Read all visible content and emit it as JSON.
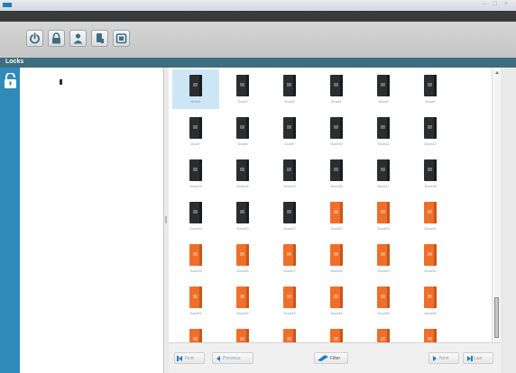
{
  "window": {
    "title": "",
    "controls": "– □ ×"
  },
  "menu": {
    "items": [
      "",
      "",
      ""
    ]
  },
  "toolbar": {
    "buttons": [
      "power-icon",
      "lock-icon",
      "user-icon",
      "device-icon",
      "tablet-icon"
    ]
  },
  "section": {
    "title": "Locks"
  },
  "tree": {
    "items": [
      {
        "label": ""
      },
      {
        "label": ""
      },
      {
        "label": ""
      }
    ]
  },
  "locks": [
    {
      "label": "Door1",
      "color": "black"
    },
    {
      "label": "Door2",
      "color": "black"
    },
    {
      "label": "Door3",
      "color": "black"
    },
    {
      "label": "Door4",
      "color": "black"
    },
    {
      "label": "Door5",
      "color": "black"
    },
    {
      "label": "Door6",
      "color": "black"
    },
    {
      "label": "Door7",
      "color": "black"
    },
    {
      "label": "Door8",
      "color": "black"
    },
    {
      "label": "Door9",
      "color": "black"
    },
    {
      "label": "Door10",
      "color": "black"
    },
    {
      "label": "Door11",
      "color": "black"
    },
    {
      "label": "Door12",
      "color": "black"
    },
    {
      "label": "Door13",
      "color": "black"
    },
    {
      "label": "Door14",
      "color": "black"
    },
    {
      "label": "Door15",
      "color": "black"
    },
    {
      "label": "Door16",
      "color": "black"
    },
    {
      "label": "Door17",
      "color": "black"
    },
    {
      "label": "Door18",
      "color": "black"
    },
    {
      "label": "Door19",
      "color": "black"
    },
    {
      "label": "Door20",
      "color": "black"
    },
    {
      "label": "Door21",
      "color": "black"
    },
    {
      "label": "Door22",
      "color": "orange"
    },
    {
      "label": "Door23",
      "color": "orange"
    },
    {
      "label": "Door24",
      "color": "orange"
    },
    {
      "label": "Door25",
      "color": "orange"
    },
    {
      "label": "Door26",
      "color": "orange"
    },
    {
      "label": "Door27",
      "color": "orange"
    },
    {
      "label": "Door28",
      "color": "orange"
    },
    {
      "label": "Door29",
      "color": "orange"
    },
    {
      "label": "Door30",
      "color": "orange"
    },
    {
      "label": "Door31",
      "color": "orange"
    },
    {
      "label": "Door32",
      "color": "orange"
    },
    {
      "label": "Door33",
      "color": "orange"
    },
    {
      "label": "Door34",
      "color": "orange"
    },
    {
      "label": "Door35",
      "color": "orange"
    },
    {
      "label": "Door36",
      "color": "orange"
    },
    {
      "label": "",
      "color": "orange"
    },
    {
      "label": "",
      "color": "orange"
    },
    {
      "label": "",
      "color": "orange"
    },
    {
      "label": "",
      "color": "orange"
    },
    {
      "label": "",
      "color": "orange"
    },
    {
      "label": "",
      "color": "orange"
    }
  ],
  "selected_index": 0,
  "footer": {
    "first_label": "First",
    "previous_label": "Previous",
    "filter_label": "Filter",
    "next_label": "Next",
    "last_label": "Last"
  },
  "colors": {
    "accent": "#2f8ab8",
    "section": "#3e6d7f",
    "lock_black": "#2b2e30",
    "lock_orange": "#ef6f2a",
    "selected": "#cde6f5"
  }
}
